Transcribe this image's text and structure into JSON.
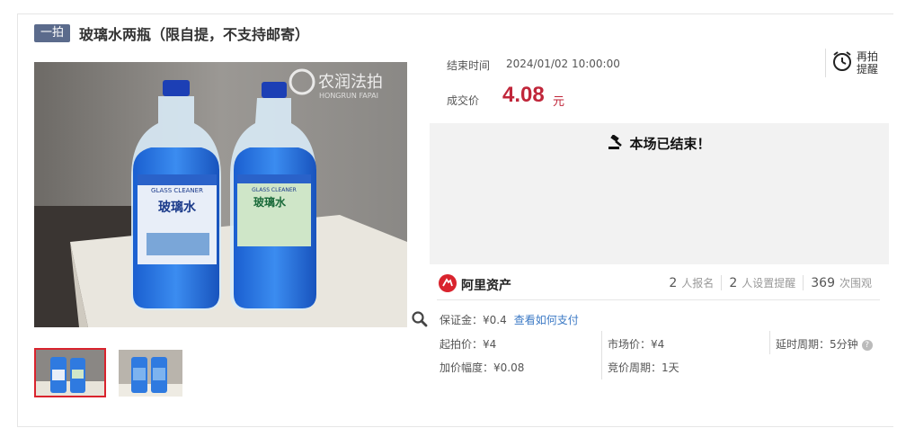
{
  "header": {
    "tag": "一拍",
    "title": "玻璃水两瓶（限自提，不支持邮寄）"
  },
  "gallery": {
    "watermark_cn": "农润法拍",
    "watermark_en": "HONGRUN FAPAI",
    "bottle_label_en": "GLASS CLEANER",
    "bottle_label_cn": "玻璃水"
  },
  "auction": {
    "end_time_label": "结束时间",
    "end_time_value": "2024/01/02 10:00:00",
    "remind_label": "再拍提醒",
    "deal_price_label": "成交价",
    "deal_price_value": "4.08",
    "deal_price_unit": "元",
    "ended_message": "本场已结束！"
  },
  "brand": {
    "name": "阿里资产"
  },
  "stats": [
    {
      "num": "2",
      "label": "人报名"
    },
    {
      "num": "2",
      "label": "人设置提醒"
    },
    {
      "num": "369",
      "label": "次围观"
    }
  ],
  "details": {
    "deposit": "保证金：¥0.4",
    "deposit_link": "查看如何支付",
    "start_price": "起拍价：¥4",
    "market_price": "市场价：¥4",
    "delay_period": "延时周期：5分钟",
    "increment": "加价幅度：¥0.08",
    "bid_period": "竞价周期：1天"
  },
  "colors": {
    "accent_red": "#c0263a",
    "tag_bg": "#5b6b8c",
    "link_blue": "#3b79c5"
  }
}
